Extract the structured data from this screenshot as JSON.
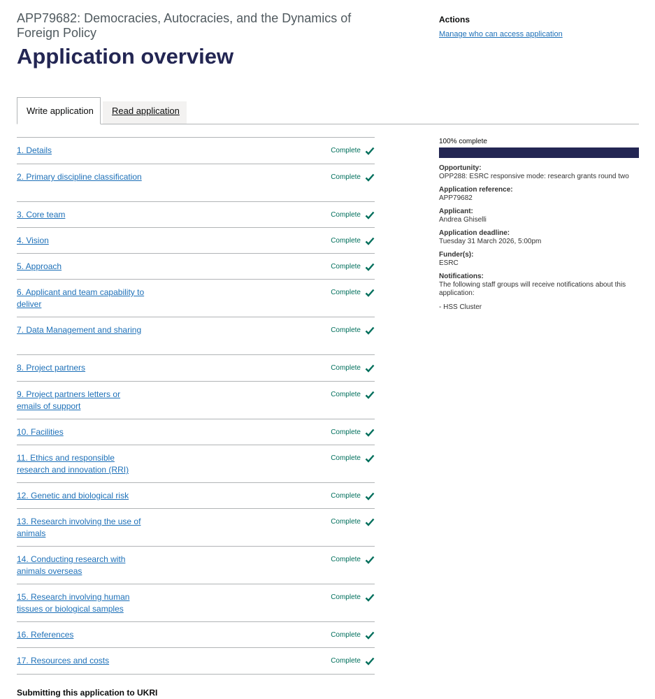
{
  "header": {
    "app_title": "APP79682: Democracies, Autocracies, and the Dynamics of Foreign Policy",
    "page_title": "Application overview"
  },
  "actions": {
    "heading": "Actions",
    "manage_link": "Manage who can access application"
  },
  "tabs": [
    {
      "label": "Write application",
      "active": true
    },
    {
      "label": "Read application",
      "active": false
    }
  ],
  "tasks": [
    {
      "label": "1. Details",
      "status": "Complete"
    },
    {
      "label": "2. Primary discipline classification",
      "status": "Complete"
    },
    {
      "label": "3. Core team",
      "status": "Complete"
    },
    {
      "label": "4. Vision",
      "status": "Complete"
    },
    {
      "label": "5. Approach",
      "status": "Complete"
    },
    {
      "label": "6. Applicant and team capability to deliver",
      "status": "Complete"
    },
    {
      "label": "7. Data Management and sharing",
      "status": "Complete"
    },
    {
      "label": "8. Project partners",
      "status": "Complete"
    },
    {
      "label": "9. Project partners letters or emails of support",
      "status": "Complete"
    },
    {
      "label": "10. Facilities",
      "status": "Complete"
    },
    {
      "label": "11. Ethics and responsible research and innovation (RRI)",
      "status": "Complete"
    },
    {
      "label": "12. Genetic and biological risk",
      "status": "Complete"
    },
    {
      "label": "13. Research involving the use of animals",
      "status": "Complete"
    },
    {
      "label": "14. Conducting research with animals overseas",
      "status": "Complete"
    },
    {
      "label": "15. Research involving human tissues or biological samples",
      "status": "Complete"
    },
    {
      "label": "16. References",
      "status": "Complete"
    },
    {
      "label": "17. Resources and costs",
      "status": "Complete"
    }
  ],
  "submit_heading": "Submitting this application to UKRI",
  "summary": {
    "progress_label": "100% complete",
    "progress_percent": 100,
    "opportunity_label": "Opportunity:",
    "opportunity_value": "OPP288: ESRC responsive mode: research grants round two",
    "reference_label": "Application reference:",
    "reference_value": "APP79682",
    "applicant_label": "Applicant:",
    "applicant_value": "Andrea Ghiselli",
    "deadline_label": "Application deadline:",
    "deadline_value": "Tuesday 31 March 2026, 5:00pm",
    "funder_label": "Funder(s):",
    "funder_value": "ESRC",
    "notifications_label": "Notifications:",
    "notifications_value": "The following staff groups will receive notifications about this application:",
    "notifications_group": "- HSS Cluster"
  },
  "colors": {
    "brand": "#232653",
    "link": "#1d70b8",
    "complete": "#006f5c"
  }
}
